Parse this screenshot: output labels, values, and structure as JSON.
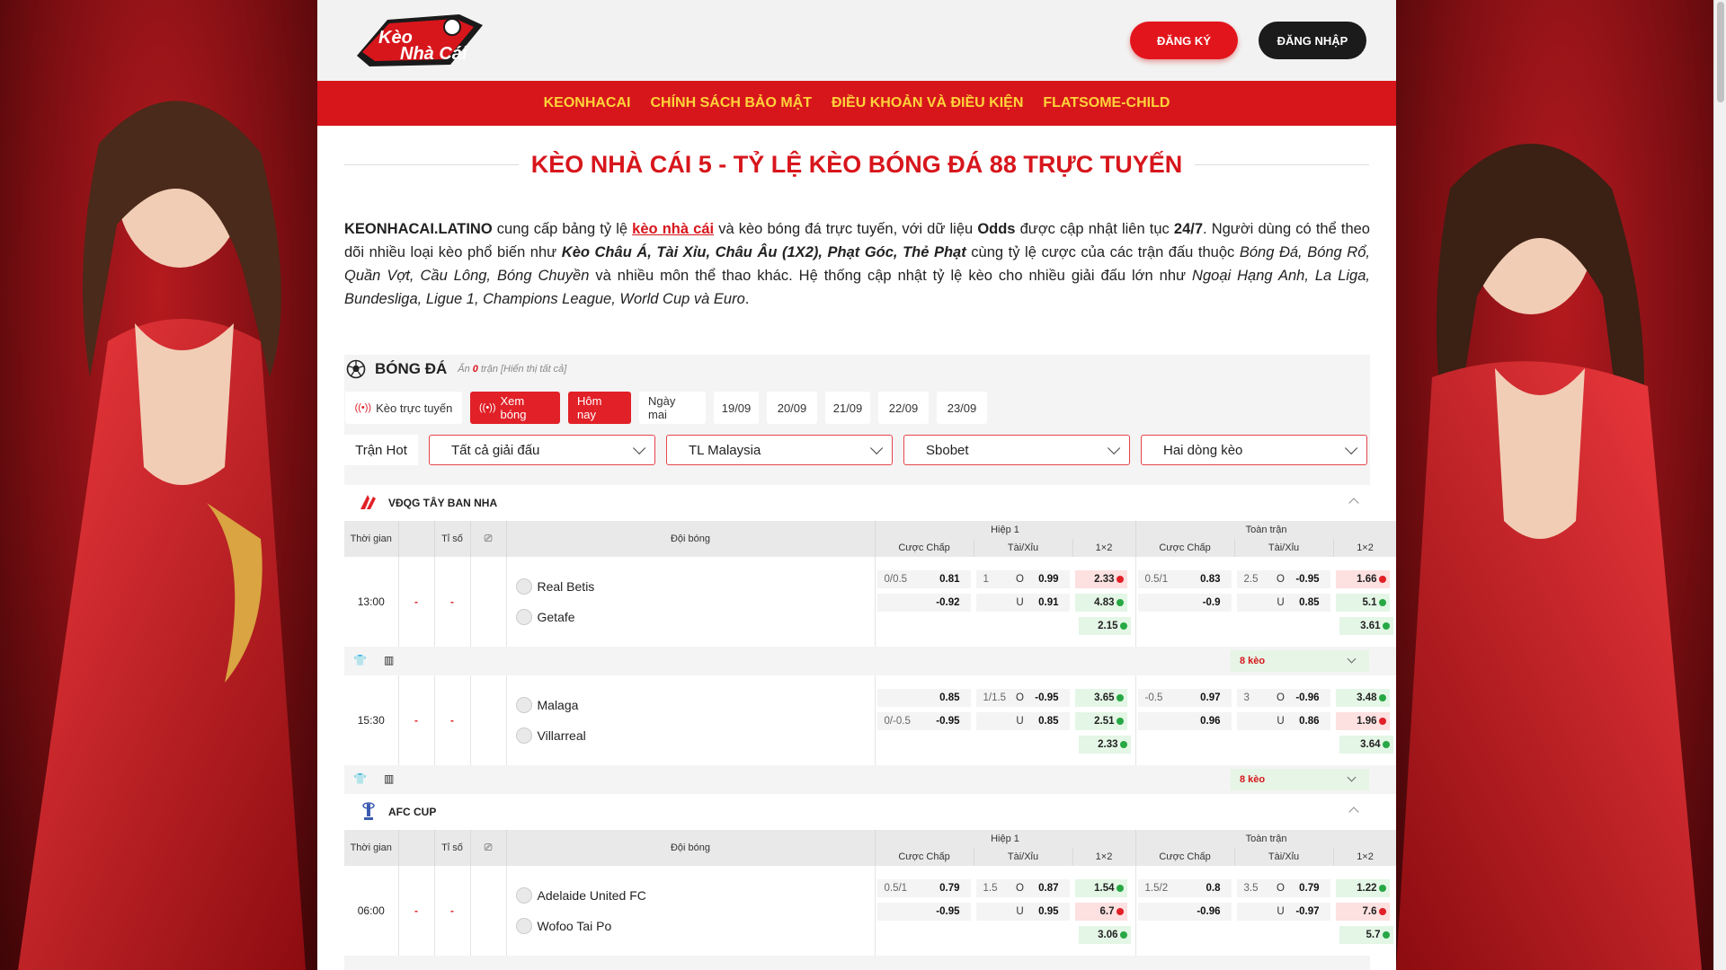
{
  "header": {
    "logo_text": "Kèo Nhà Cái",
    "register_label": "ĐĂNG KÝ",
    "login_label": "ĐĂNG NHẬP"
  },
  "nav": [
    "KEONHACAI",
    "CHÍNH SÁCH BẢO MẬT",
    "ĐIỀU KHOẢN VÀ ĐIỀU KIỆN",
    "FLATSOME-CHILD"
  ],
  "page_title": "KÈO NHÀ CÁI 5 - TỶ LỆ KÈO BÓNG ĐÁ 88 TRỰC TUYẾN",
  "intro": {
    "site": "KEONHACAI.LATINO",
    "p1": " cung cấp bảng tỷ lệ ",
    "link": "kèo nhà cái",
    "p2": " và kèo bóng đá trực tuyến, với dữ liệu ",
    "odds": "Odds",
    "p3": " được cập nhật liên tục ",
    "always": "24/7",
    "p4": ". Người dùng có thể theo dõi nhiều loại kèo phổ biến như ",
    "types": "Kèo Châu Á, Tài Xỉu, Châu Âu (1X2), Phạt Góc, Thẻ Phạt",
    "p5": " cùng tỷ lệ cược của các trận đấu thuộc ",
    "sports": "Bóng Đá, Bóng Rổ, Quần Vợt, Cầu Lông, Bóng Chuyền",
    "p6": " và nhiều môn thể thao khác. Hệ thống cập nhật tỷ lệ kèo cho nhiều giải đấu lớn như ",
    "leagues": "Ngoại Hạng Anh, La Liga, Bundesliga, Ligue 1, Champions League, World Cup và Euro",
    "p7": "."
  },
  "widget": {
    "sport": "BÓNG ĐÁ",
    "hidden_prefix": "Ẩn ",
    "hidden_count": "0",
    "hidden_suffix": " trận [Hiển thị tất cả]",
    "chips": [
      {
        "label": "Kèo trực tuyến",
        "live": true,
        "active": false
      },
      {
        "label": "Xem bóng",
        "live": true,
        "active": true
      },
      {
        "label": "Hôm nay",
        "live": false,
        "active": true
      },
      {
        "label": "Ngày mai",
        "live": false,
        "active": false
      },
      {
        "label": "19/09",
        "live": false,
        "active": false
      },
      {
        "label": "20/09",
        "live": false,
        "active": false
      },
      {
        "label": "21/09",
        "live": false,
        "active": false
      },
      {
        "label": "22/09",
        "live": false,
        "active": false
      },
      {
        "label": "23/09",
        "live": false,
        "active": false
      }
    ],
    "hot_label": "Trận Hot",
    "selects": [
      "Tất cả giải đấu",
      "TL Malaysia",
      "Sbobet",
      "Hai dòng kèo"
    ],
    "columns": {
      "time": "Thời gian",
      "score": "Tỉ số",
      "teams": "Đội bóng",
      "half": "Hiệp 1",
      "full": "Toàn trận",
      "hdp": "Cược Chấp",
      "ou": "Tài/Xỉu",
      "x12": "1×2"
    },
    "more_label": "8 kèo",
    "leagues": [
      {
        "name": "VĐQG TÂY BAN NHA",
        "matches": [
          {
            "time": "13:00",
            "score_a": "-",
            "score_b": "-",
            "home": "Real Betis",
            "away": "Getafe",
            "rows": [
              {
                "h1_hdp": "0/0.5",
                "h1_hdp_v": "0.81",
                "h1_ou": "1",
                "h1_ou_s": "O",
                "h1_ou_v": "0.99",
                "h1_x": "2.33",
                "h1_xc": "red",
                "f_hdp": "0.5/1",
                "f_hdp_v": "0.83",
                "f_ou": "2.5",
                "f_ou_s": "O",
                "f_ou_v": "-0.95",
                "f_x": "1.66",
                "f_xc": "red"
              },
              {
                "h1_hdp": "",
                "h1_hdp_v": "-0.92",
                "h1_ou": "",
                "h1_ou_s": "U",
                "h1_ou_v": "0.91",
                "h1_x": "4.83",
                "h1_xc": "green",
                "f_hdp": "",
                "f_hdp_v": "-0.9",
                "f_ou": "",
                "f_ou_s": "U",
                "f_ou_v": "0.85",
                "f_x": "5.1",
                "f_xc": "green"
              },
              {
                "h1_x": "2.15",
                "h1_xc": "green",
                "f_x": "3.61",
                "f_xc": "green"
              }
            ]
          },
          {
            "time": "15:30",
            "score_a": "-",
            "score_b": "-",
            "home": "Malaga",
            "away": "Villarreal",
            "rows": [
              {
                "h1_hdp": "",
                "h1_hdp_v": "0.85",
                "h1_ou": "1/1.5",
                "h1_ou_s": "O",
                "h1_ou_v": "-0.95",
                "h1_x": "3.65",
                "h1_xc": "green",
                "f_hdp": "-0.5",
                "f_hdp_v": "0.97",
                "f_ou": "3",
                "f_ou_s": "O",
                "f_ou_v": "-0.96",
                "f_x": "3.48",
                "f_xc": "green"
              },
              {
                "h1_hdp": "0/-0.5",
                "h1_hdp_v": "-0.95",
                "h1_ou": "",
                "h1_ou_s": "U",
                "h1_ou_v": "0.85",
                "h1_x": "2.51",
                "h1_xc": "green",
                "f_hdp": "",
                "f_hdp_v": "0.96",
                "f_ou": "",
                "f_ou_s": "U",
                "f_ou_v": "0.86",
                "f_x": "1.96",
                "f_xc": "red"
              },
              {
                "h1_x": "2.33",
                "h1_xc": "green",
                "f_x": "3.64",
                "f_xc": "green"
              }
            ]
          }
        ]
      },
      {
        "name": "AFC CUP",
        "matches": [
          {
            "time": "06:00",
            "score_a": "-",
            "score_b": "-",
            "home": "Adelaide United FC",
            "away": "Wofoo Tai Po",
            "rows": [
              {
                "h1_hdp": "0.5/1",
                "h1_hdp_v": "0.79",
                "h1_ou": "1.5",
                "h1_ou_s": "O",
                "h1_ou_v": "0.87",
                "h1_x": "1.54",
                "h1_xc": "green",
                "f_hdp": "1.5/2",
                "f_hdp_v": "0.8",
                "f_ou": "3.5",
                "f_ou_s": "O",
                "f_ou_v": "0.79",
                "f_x": "1.22",
                "f_xc": "green"
              },
              {
                "h1_hdp": "",
                "h1_hdp_v": "-0.95",
                "h1_ou": "",
                "h1_ou_s": "U",
                "h1_ou_v": "0.95",
                "h1_x": "6.7",
                "h1_xc": "red",
                "f_hdp": "",
                "f_hdp_v": "-0.96",
                "f_ou": "",
                "f_ou_s": "U",
                "f_ou_v": "-0.97",
                "f_x": "7.6",
                "f_xc": "red"
              },
              {
                "h1_x": "3.06",
                "h1_xc": "green",
                "f_x": "5.7",
                "f_xc": "green"
              }
            ]
          }
        ]
      }
    ]
  },
  "colors": {
    "brand_red": "#d7161c",
    "nav_text": "#ffd33a",
    "dark_button": "#1b1b1b"
  }
}
